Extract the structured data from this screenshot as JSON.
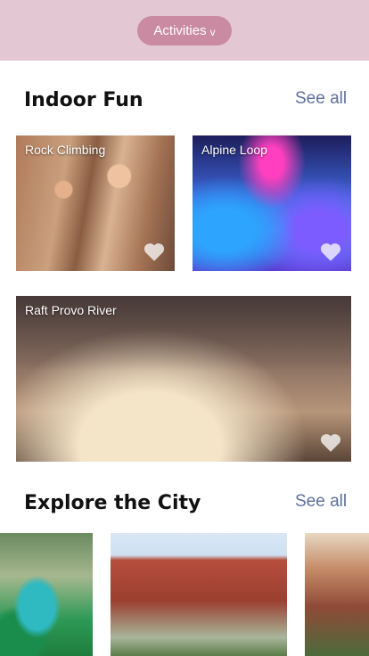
{
  "header": {
    "activities_label": "Activities",
    "chevron": "v"
  },
  "section1": {
    "title": "Indoor Fun",
    "see_all": "See all",
    "cards": [
      {
        "label": "Rock Climbing"
      },
      {
        "label": "Alpine Loop"
      },
      {
        "label": "Raft Provo River"
      }
    ]
  },
  "section2": {
    "title": "Explore the City",
    "see_all": "See all"
  },
  "colors": {
    "header_bg": "#e3c8d3",
    "pill_bg": "#c98aa2",
    "link": "#5f6f9a"
  }
}
